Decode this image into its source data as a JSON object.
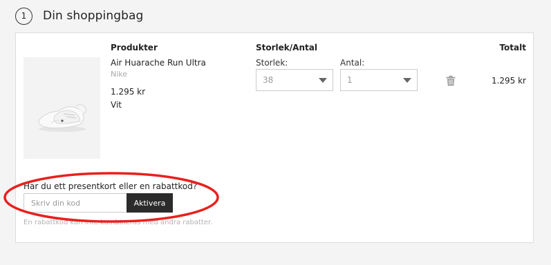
{
  "step": {
    "number": "1",
    "title": "Din shoppingbag"
  },
  "columns": {
    "products": "Produkter",
    "size_qty": "Storlek/Antal",
    "total": "Totalt"
  },
  "item": {
    "name": "Air Huarache Run Ultra",
    "brand": "Nike",
    "price": "1.295 kr",
    "color": "Vit",
    "size_label": "Storlek:",
    "size_value": "38",
    "qty_label": "Antal:",
    "qty_value": "1",
    "total": "1.295 kr",
    "image_icon": "sneaker-image",
    "remove_icon": "trash-icon"
  },
  "promo": {
    "question": "Har du ett presentkort eller en rabattkod?",
    "placeholder": "Skriv din kod",
    "button": "Aktivera",
    "note": "En rabattkod kan inte kombineras med andra rabatter."
  },
  "annotation": {
    "color": "#e8201c"
  }
}
